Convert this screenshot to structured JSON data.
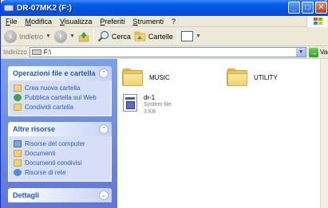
{
  "window": {
    "title": "DR-07MK2 (F:)"
  },
  "titlebar": {
    "minimize": "_",
    "maximize": "□",
    "close": "✕"
  },
  "menu": [
    "File",
    "Modifica",
    "Visualizza",
    "Preferiti",
    "Strumenti",
    "?"
  ],
  "toolbar": {
    "back_label": "Indietro",
    "forward_label": "",
    "search_label": "Cerca",
    "folders_label": "Cartelle"
  },
  "address": {
    "label": "Indirizzo",
    "value": "F:\\",
    "go_label": "Vai"
  },
  "tasks": {
    "file_folder": {
      "title": "Operazioni file e cartella",
      "links": [
        "Crea nuova cartella",
        "Pubblica cartella sul Web",
        "Condividi cartella"
      ]
    },
    "other_places": {
      "title": "Altre risorse",
      "links": [
        "Risorse del computer",
        "Documenti",
        "Documenti condivisi",
        "Risorse di rete"
      ]
    },
    "details": {
      "title": "Dettagli"
    }
  },
  "items": {
    "folders": [
      "MUSIC",
      "UTILITY"
    ],
    "file": {
      "name": "dr-1",
      "type": "System file",
      "size": "3 KB"
    }
  },
  "colors": {
    "titlebar": "#0a5fe8",
    "task_pane": "#6f8fe0",
    "link": "#215dc6"
  }
}
